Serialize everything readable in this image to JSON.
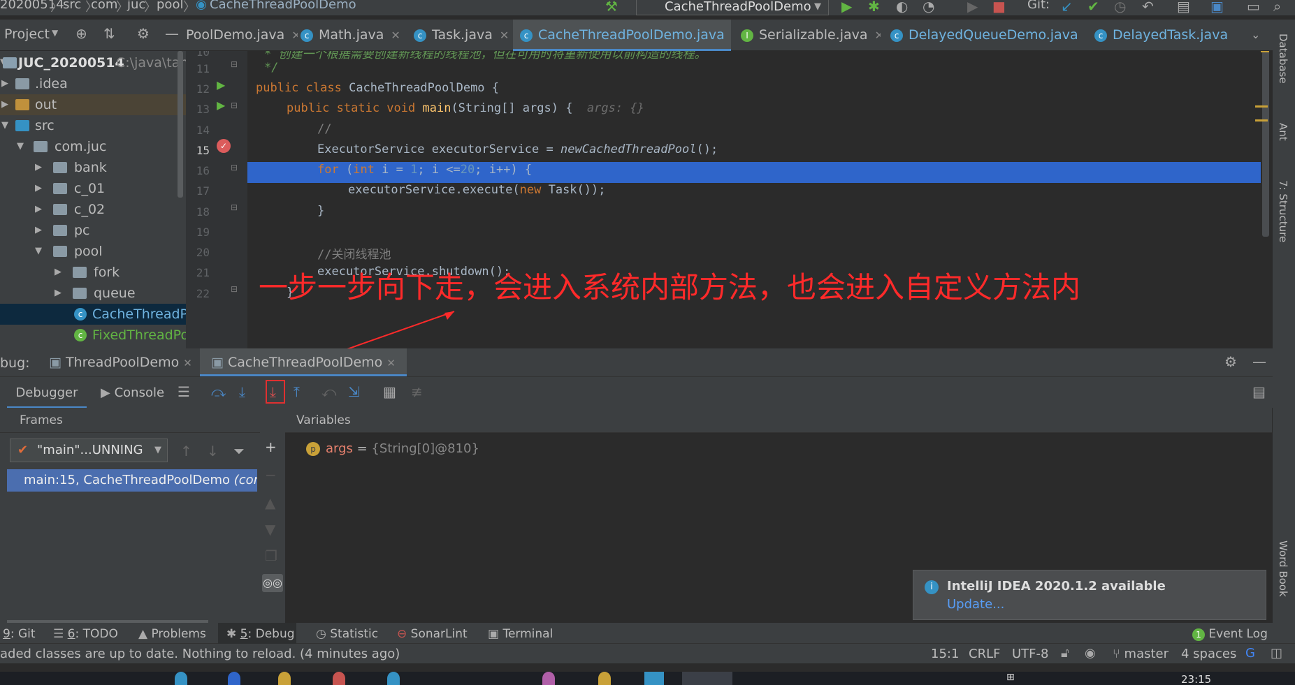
{
  "nav": {
    "project_frag": "20200514",
    "crumbs": [
      "src",
      "com",
      "juc",
      "pool"
    ],
    "current_file": "CacheThreadPoolDemo",
    "run_config": "CacheThreadPoolDemo",
    "git_label": "Git:"
  },
  "toolbar": {
    "project_label": "Project"
  },
  "tabs": [
    {
      "label": "PoolDemo.java",
      "icon": "class-icon"
    },
    {
      "label": "Math.java",
      "icon": "class-icon"
    },
    {
      "label": "Task.java",
      "icon": "class-icon"
    },
    {
      "label": "CacheThreadPoolDemo.java",
      "icon": "class-icon"
    },
    {
      "label": "Serializable.java",
      "icon": "interface-icon"
    },
    {
      "label": "DelayedQueueDemo.java",
      "icon": "class-icon"
    },
    {
      "label": "DelayedTask.java",
      "icon": "class-icon"
    }
  ],
  "tree": {
    "root_name": "JUC_20200514",
    "root_path": "C:\\java\\tank",
    "items": [
      ".idea",
      "out",
      "src",
      "com.juc",
      "bank",
      "c_01",
      "c_02",
      "pc",
      "pool",
      "fork",
      "queue",
      "CacheThreadPoolDemo",
      "FixedThreadPoolDemo"
    ]
  },
  "editor": {
    "line_numbers": [
      "10",
      "11",
      "12",
      "13",
      "14",
      "15",
      "16",
      "17",
      "18",
      "19",
      "20",
      "21",
      "22"
    ],
    "comment_line": "* 创建一个根据需要创建新线程的线程池，但在可用时将重新使用以前构造的线程。",
    "comment_end": "*/",
    "class_line": {
      "kw": "public class",
      "name": "CacheThreadPoolDemo",
      "rest": "{"
    },
    "main_line": {
      "kw": "public static void",
      "fn": "main",
      "params": "(String[] args) {",
      "hint": "args: {}"
    },
    "line14": "//",
    "line15": {
      "type": "ExecutorService executorService = ",
      "call": "newCachedThreadPool",
      "end": "();"
    },
    "line16": {
      "kw": "for",
      "a": " (",
      "kw2": "int",
      "b": " i = ",
      "n1": "1",
      "c": "; i <=",
      "n2": "20",
      "d": "; i++) {"
    },
    "line17": {
      "a": "executorService.execute(",
      "kw": "new",
      "b": " Task());"
    },
    "line18": "}",
    "line20": "//关闭线程池",
    "line21": "executorService.shutdown();",
    "line22": "}"
  },
  "annotation": "一步一步向下走，会进入系统内部方法，也会进入自定义方法内",
  "debug": {
    "label": "bug:",
    "tabs": [
      "ThreadPoolDemo",
      "CacheThreadPoolDemo"
    ],
    "subtabs": [
      "Debugger",
      "Console"
    ],
    "frames_title": "Frames",
    "thread": "\"main\"...UNNING",
    "frame": "main:15, CacheThreadPoolDemo",
    "frame_pkg": "(com.",
    "vars_title": "Variables",
    "var_name": "args",
    "var_eq": " = ",
    "var_value": "{String[0]@810}"
  },
  "notification": {
    "title": "IntelliJ IDEA 2020.1.2 available",
    "link": "Update..."
  },
  "bottom_tools": [
    {
      "num": "9",
      "label": ": Git"
    },
    {
      "num": "6",
      "label": ": TODO"
    },
    {
      "num": "",
      "label": "Problems"
    },
    {
      "num": "5",
      "label": ": Debug"
    },
    {
      "num": "",
      "label": "Statistic"
    },
    {
      "num": "",
      "label": "SonarLint"
    },
    {
      "num": "",
      "label": "Terminal"
    }
  ],
  "event_log": "Event Log",
  "event_count": "1",
  "status": {
    "message": "aded classes are up to date. Nothing to reload. (4 minutes ago)",
    "position": "15:1",
    "line_sep": "CRLF",
    "encoding": "UTF-8",
    "branch": "master",
    "indent": "4 spaces"
  },
  "right_strip": [
    "Database",
    "Ant",
    "7: Structure",
    "Word Book"
  ],
  "taskbar_time": "23:15",
  "colors": {
    "accent": "#4a88c7",
    "highlight": "#2f65ca",
    "annotation": "#ff2a2a"
  }
}
